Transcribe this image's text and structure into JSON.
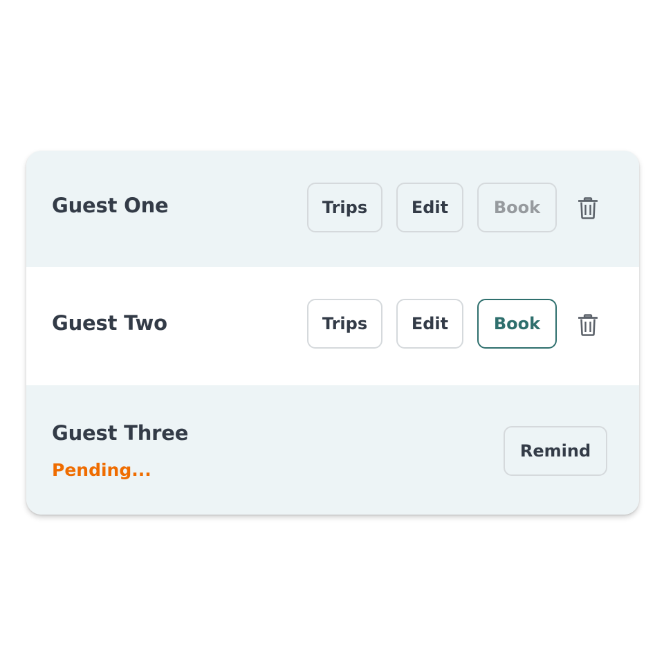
{
  "guests": [
    {
      "name": "Guest One",
      "actions": {
        "trips": "Trips",
        "edit": "Edit",
        "book": "Book"
      },
      "book_state": "disabled",
      "delete_icon": "trash-icon"
    },
    {
      "name": "Guest Two",
      "actions": {
        "trips": "Trips",
        "edit": "Edit",
        "book": "Book"
      },
      "book_state": "active",
      "delete_icon": "trash-icon"
    },
    {
      "name": "Guest Three",
      "status": "Pending...",
      "actions": {
        "remind": "Remind"
      }
    }
  ],
  "colors": {
    "row_alt_background": "#edf4f6",
    "text_primary": "#333b47",
    "button_border": "#d5d9dc",
    "disabled_text": "#969a9e",
    "accent_teal": "#2e6f6d",
    "pending_orange": "#ef6c00",
    "icon_gray": "#5b6169"
  }
}
